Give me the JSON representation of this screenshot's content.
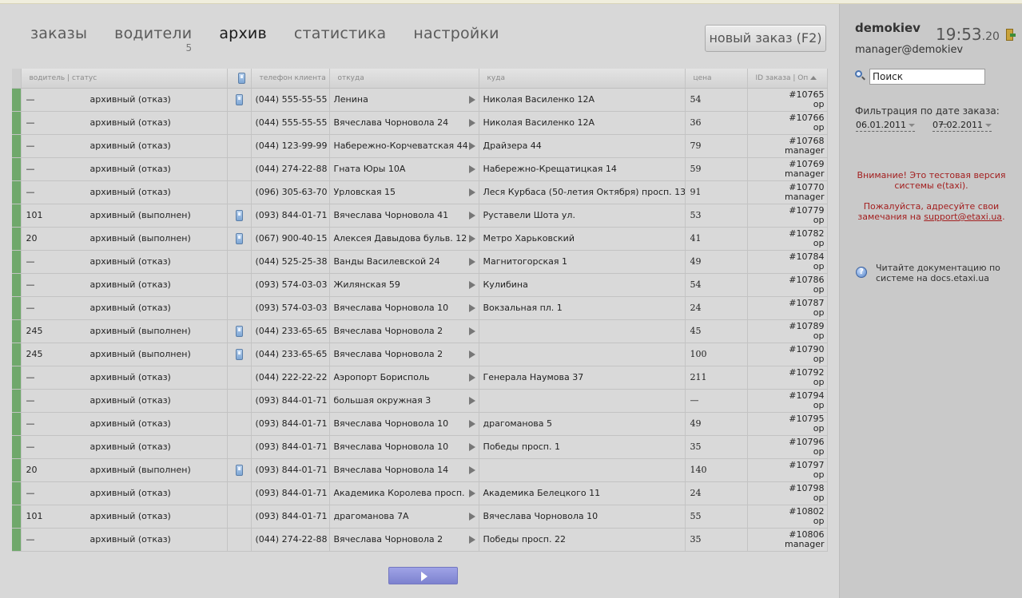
{
  "nav": {
    "orders": "заказы",
    "drivers": "водители",
    "drivers_count": "5",
    "archive": "архив",
    "stats": "статистика",
    "settings": "настройки"
  },
  "new_order_label": "новый заказ (F2)",
  "table": {
    "headers": {
      "driver_status": "водитель | статус",
      "phone_client": "телефон клиента",
      "from": "откуда",
      "to": "куда",
      "price": "цена",
      "order_id": "ID заказа | Оп"
    },
    "rows": [
      {
        "driver": "—",
        "status": "архивный (отказ)",
        "mobile": true,
        "tel": "(044) 555-55-55",
        "from": "Ленина",
        "to": "Николая Василенко 12А",
        "price": "54",
        "id": "#10765",
        "op": "ор"
      },
      {
        "driver": "—",
        "status": "архивный (отказ)",
        "mobile": false,
        "tel": "(044) 555-55-55",
        "from": "Вячеслава Чорновола 24",
        "to": "Николая Василенко 12А",
        "price": "36",
        "id": "#10766",
        "op": "ор"
      },
      {
        "driver": "—",
        "status": "архивный (отказ)",
        "mobile": false,
        "tel": "(044) 123-99-99",
        "from": "Набережно-Корчеватская 44",
        "to": "Драйзера 44",
        "price": "79",
        "id": "#10768",
        "op": "manager"
      },
      {
        "driver": "—",
        "status": "архивный (отказ)",
        "mobile": false,
        "tel": "(044) 274-22-88",
        "from": "Гната Юры 10А",
        "to": "Набережно-Крещатицкая 14",
        "price": "59",
        "id": "#10769",
        "op": "manager"
      },
      {
        "driver": "—",
        "status": "архивный (отказ)",
        "mobile": false,
        "tel": "(096) 305-63-70",
        "from": "Урловская 15",
        "to": "Леся Курбаса (50-летия Октября) просп. 13",
        "price": "91",
        "id": "#10770",
        "op": "manager"
      },
      {
        "driver": "101",
        "status": "архивный (выполнен)",
        "mobile": true,
        "tel": "(093) 844-01-71",
        "from": "Вячеслава Чорновола 41",
        "to": "Руставели Шота ул.",
        "price": "53",
        "id": "#10779",
        "op": "ор"
      },
      {
        "driver": "20",
        "status": "архивный (выполнен)",
        "mobile": true,
        "tel": "(067) 900-40-15",
        "from": "Алексея Давыдова бульв. 12",
        "to": "Метро Харьковский",
        "price": "41",
        "id": "#10782",
        "op": "ор"
      },
      {
        "driver": "—",
        "status": "архивный (отказ)",
        "mobile": false,
        "tel": "(044) 525-25-38",
        "from": "Ванды Василевской 24",
        "to": "Магнитогорская 1",
        "price": "49",
        "id": "#10784",
        "op": "ор"
      },
      {
        "driver": "—",
        "status": "архивный (отказ)",
        "mobile": false,
        "tel": "(093) 574-03-03",
        "from": "Жилянская 59",
        "to": "Кулибина",
        "price": "54",
        "id": "#10786",
        "op": "ор"
      },
      {
        "driver": "—",
        "status": "архивный (отказ)",
        "mobile": false,
        "tel": "(093) 574-03-03",
        "from": "Вячеслава Чорновола 10",
        "to": "Вокзальная пл. 1",
        "price": "24",
        "id": "#10787",
        "op": "ор"
      },
      {
        "driver": "245",
        "status": "архивный (выполнен)",
        "mobile": true,
        "tel": "(044) 233-65-65",
        "from": "Вячеслава Чорновола 2",
        "to": "",
        "price": "45",
        "id": "#10789",
        "op": "ор"
      },
      {
        "driver": "245",
        "status": "архивный (выполнен)",
        "mobile": true,
        "tel": "(044) 233-65-65",
        "from": "Вячеслава Чорновола 2",
        "to": "",
        "price": "100",
        "id": "#10790",
        "op": "ор"
      },
      {
        "driver": "—",
        "status": "архивный (отказ)",
        "mobile": false,
        "tel": "(044) 222-22-22",
        "from": "Аэропорт Борисполь",
        "to": "Генерала Наумова 37",
        "price": "211",
        "id": "#10792",
        "op": "ор"
      },
      {
        "driver": "—",
        "status": "архивный (отказ)",
        "mobile": false,
        "tel": "(093) 844-01-71",
        "from": "большая окружная 3",
        "to": "",
        "price": "—",
        "id": "#10794",
        "op": "ор"
      },
      {
        "driver": "—",
        "status": "архивный (отказ)",
        "mobile": false,
        "tel": "(093) 844-01-71",
        "from": "Вячеслава Чорновола 10",
        "to": "драгоманова 5",
        "price": "49",
        "id": "#10795",
        "op": "ор"
      },
      {
        "driver": "—",
        "status": "архивный (отказ)",
        "mobile": false,
        "tel": "(093) 844-01-71",
        "from": "Вячеслава Чорновола 10",
        "to": "Победы просп. 1",
        "price": "35",
        "id": "#10796",
        "op": "ор"
      },
      {
        "driver": "20",
        "status": "архивный (выполнен)",
        "mobile": true,
        "tel": "(093) 844-01-71",
        "from": "Вячеслава Чорновола 14",
        "to": "",
        "price": "140",
        "id": "#10797",
        "op": "ор"
      },
      {
        "driver": "—",
        "status": "архивный (отказ)",
        "mobile": false,
        "tel": "(093) 844-01-71",
        "from": "Академика Королева просп.",
        "to": "Академика Белецкого 11",
        "price": "24",
        "id": "#10798",
        "op": "ор"
      },
      {
        "driver": "101",
        "status": "архивный (отказ)",
        "mobile": false,
        "tel": "(093) 844-01-71",
        "from": "драгоманова 7А",
        "to": "Вячеслава Чорновола 10",
        "price": "55",
        "id": "#10802",
        "op": "ор"
      },
      {
        "driver": "—",
        "status": "архивный (отказ)",
        "mobile": false,
        "tel": "(044) 274-22-88",
        "from": "Вячеслава Чорновола 2",
        "to": "Победы просп. 22",
        "price": "35",
        "id": "#10806",
        "op": "manager"
      }
    ]
  },
  "sidebar": {
    "username": "demokiev",
    "clock_hm": "19:53",
    "clock_sec": ".20",
    "email": "manager@demokiev",
    "search_placeholder": "Поиск",
    "filter_label": "Фильтрация по дате заказа:",
    "date_from": "06.01.2011",
    "date_sep": "—",
    "date_to": "07.02.2011",
    "warning_1": "Внимание! Это тестовая версия системы e(taxi).",
    "warning_2_text": "Пожалуйста, адресуйте свои замечания на",
    "warning_2_link": "support@etaxi.ua",
    "warning_2_end": ".",
    "help_text": "Читайте документацию по системе на docs.etaxi.ua"
  },
  "icons": {
    "mobile": "mobile-phone-icon",
    "route_arrow": "arrow-right-icon",
    "sort": "sort-up-icon",
    "search": "search-icon",
    "help": "help-icon",
    "exit": "exit-icon",
    "next": "next-page-icon"
  },
  "colors": {
    "row_marker": "#6fa86b",
    "warning": "#a31f1f",
    "next_button": "#8d91dc"
  }
}
